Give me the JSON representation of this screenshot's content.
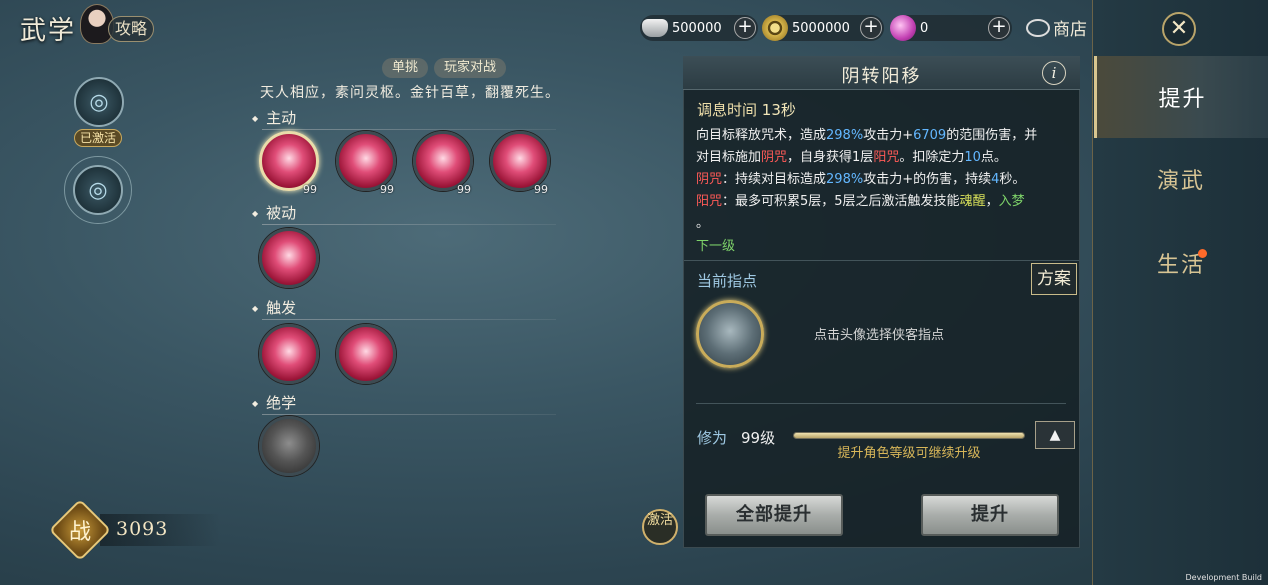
{
  "header": {
    "title": "武学",
    "guide_label": "攻略"
  },
  "currency": {
    "silver": "500000",
    "copper": "5000000",
    "gem": "0",
    "shop_label": "商店"
  },
  "skill_tree": {
    "activated_label": "已激活"
  },
  "modes": [
    "单挑",
    "玩家对战"
  ],
  "motto": "天人相应，素问灵枢。金针百草，翻覆死生。",
  "sections": {
    "active": "主动",
    "passive": "被动",
    "trigger": "触发",
    "ultimate": "绝学"
  },
  "skills": {
    "active_levels": [
      "99",
      "99",
      "99",
      "99"
    ]
  },
  "combat_power": {
    "label": "战",
    "value": "3093"
  },
  "activate_button": "激活",
  "detail": {
    "title": "阴转阳移",
    "info_icon": "i",
    "cooldown_label": "调息时间",
    "cooldown_value": "13秒",
    "desc": {
      "l1_a": "向目标释放咒术，造成",
      "l1_b": "298%",
      "l1_c": "攻击力+",
      "l1_d": "6709",
      "l1_e": "的范围伤害，并",
      "l2_a": "对目标施加",
      "l2_b": "阴咒",
      "l2_c": "，自身获得1层",
      "l2_d": "阳咒",
      "l2_e": "。扣除定力",
      "l2_f": "10",
      "l2_g": "点。",
      "l3_a": "阴咒",
      "l3_b": "：持续对目标造成",
      "l3_c": "298%",
      "l3_d": "攻击力+的伤害，持续",
      "l3_e": "4",
      "l3_f": "秒。",
      "l4_a": "阳咒",
      "l4_b": "：最多可积累5层，5层之后激活触发技能",
      "l4_c": "魂醒",
      "l4_d": "，",
      "l4_e": "入梦",
      "l5": "。"
    },
    "next_level": "下一级",
    "guide_label": "当前指点",
    "plan_button": "方案",
    "guide_hint": "点击头像选择侠客指点",
    "cultivation_label": "修为",
    "cultivation_level": "99级",
    "cultivation_progress": 1.0,
    "cultivation_tip": "提升角色等级可继续升级",
    "upgrade_all_button": "全部提升",
    "upgrade_button": "提升"
  },
  "sidebar": {
    "tabs": [
      "提升",
      "演武",
      "生活"
    ],
    "active_tab": 0
  },
  "dev_label": "Development Build",
  "colors": {
    "accent_gold": "#d8c690",
    "highlight_blue": "#63b7ff",
    "curse_red": "#ff5a57",
    "next_green": "#7ed36a",
    "notify_orange": "#ff6a2a"
  }
}
